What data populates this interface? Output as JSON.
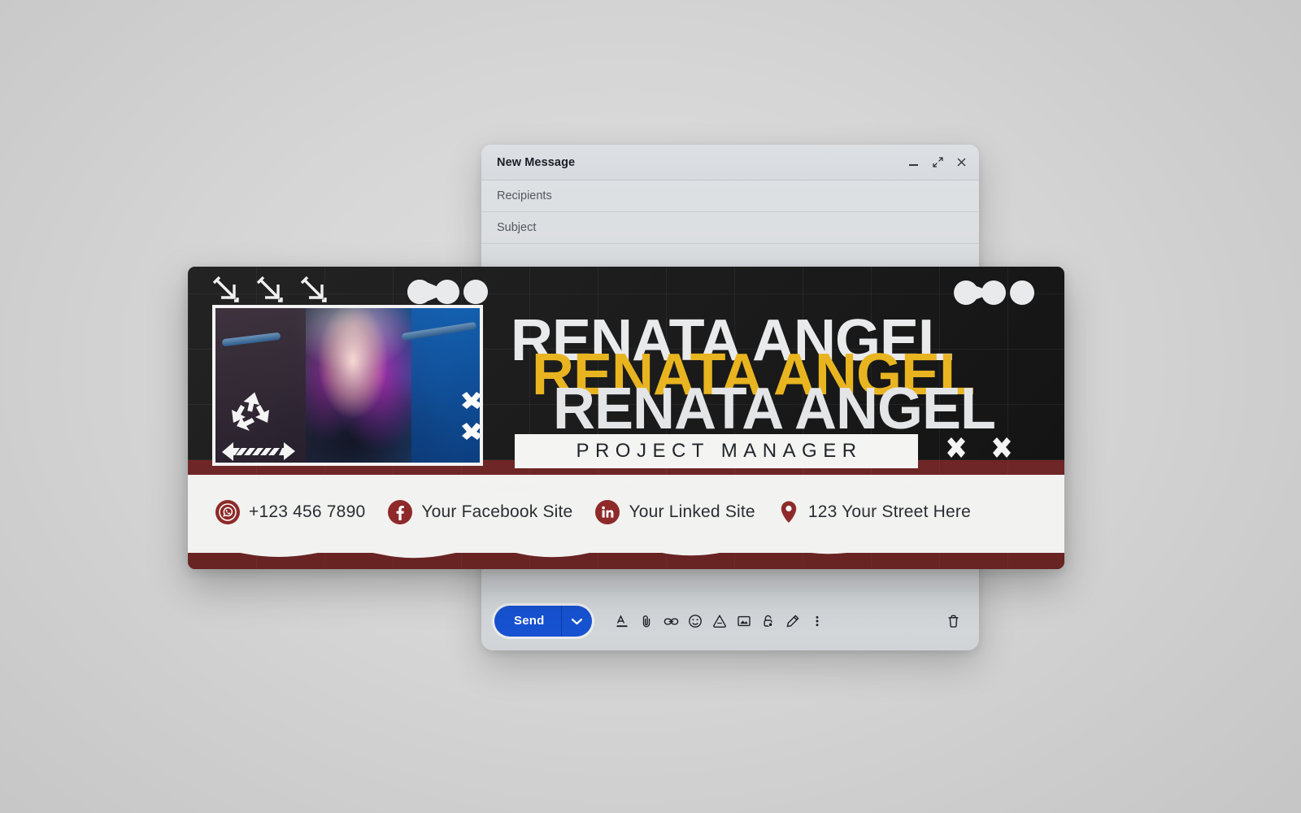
{
  "window": {
    "title": "New Message",
    "controls": [
      {
        "name": "minimize-icon",
        "label": "minimize"
      },
      {
        "name": "expand-icon",
        "label": "expand"
      },
      {
        "name": "close-icon",
        "label": "close"
      }
    ],
    "fields": [
      {
        "name": "recipients",
        "placeholder": "Recipients",
        "value": ""
      },
      {
        "name": "subject",
        "placeholder": "Subject",
        "value": ""
      }
    ],
    "toolbar": {
      "send_label": "Send",
      "send_color": "#1752d1",
      "dropdown_icon": "chevron-down-icon",
      "icons": [
        "formatting-icon",
        "attach-file-icon",
        "insert-link-icon",
        "insert-emoji-icon",
        "insert-drive-icon",
        "insert-photo-icon",
        "confidential-mode-icon",
        "signature-pen-icon",
        "more-options-icon"
      ],
      "trash_icon": "delete-draft-icon"
    }
  },
  "signature": {
    "name_layers": [
      "RENATA ANGEL",
      "RENATA ANGEL",
      "RENATA ANGEL"
    ],
    "role": "PROJECT MANAGER",
    "colors": {
      "dark": "#1c1c1c",
      "red": "#6b2424",
      "gold": "#e8b420",
      "white": "#f2f2f0"
    },
    "photo_alt": "Portrait of woman with purple hair in blue-lit urban alley",
    "decor": {
      "arrows": [
        "arrow-down-right-1",
        "arrow-down-right-2",
        "arrow-down-right-3"
      ],
      "dots_mid": "merged-dots-shape",
      "dots_right": "merged-dots-shape",
      "recycle": "recycle-icon",
      "stripe_arrow": "striped-arrow-icon",
      "crosses": [
        "cross-icon",
        "cross-icon",
        "cross-icon",
        "cross-icon"
      ]
    },
    "contacts": [
      {
        "icon": "whatsapp-icon",
        "text": "+123 456 7890"
      },
      {
        "icon": "facebook-icon",
        "text": "Your Facebook Site"
      },
      {
        "icon": "linkedin-icon",
        "text": "Your Linked Site"
      },
      {
        "icon": "location-pin-icon",
        "text": "123 Your Street Here"
      }
    ]
  }
}
